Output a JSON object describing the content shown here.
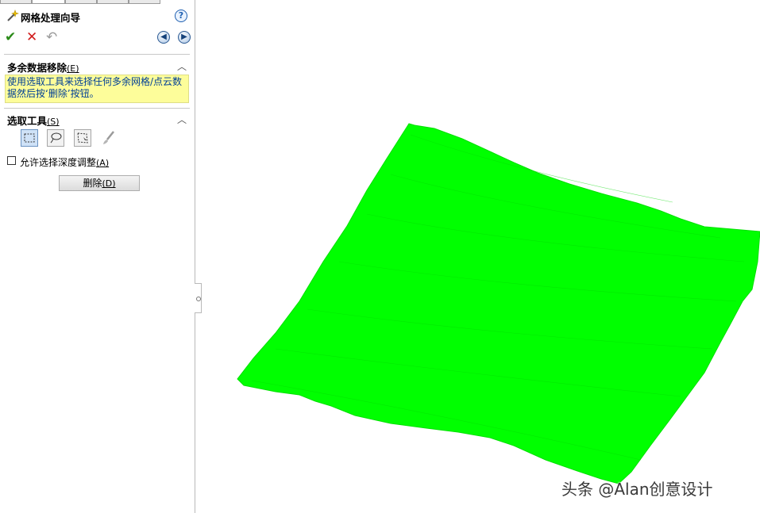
{
  "panel": {
    "title": "网格处理向导",
    "help_icon": "?",
    "actions": {
      "ok_icon": "✔",
      "cancel_icon": "✕",
      "undo_icon": "↶",
      "back_icon": "◀",
      "forward_icon": "▶"
    },
    "section_remove": {
      "title": "多余数据移除",
      "shortcut": "(E)",
      "message": "使用选取工具来选择任何多余网格/点云数据然后按‘删除’按钮。"
    },
    "section_tools": {
      "title": "选取工具",
      "shortcut": "(S)",
      "checkbox_label": "允许选择深度调整",
      "checkbox_shortcut": "(A)",
      "checkbox_checked": false,
      "delete_button": "删除",
      "delete_shortcut": "(D)"
    }
  },
  "viewport": {
    "mesh_color": "#00ff00"
  },
  "watermark": "头条 @Alan创意设计"
}
